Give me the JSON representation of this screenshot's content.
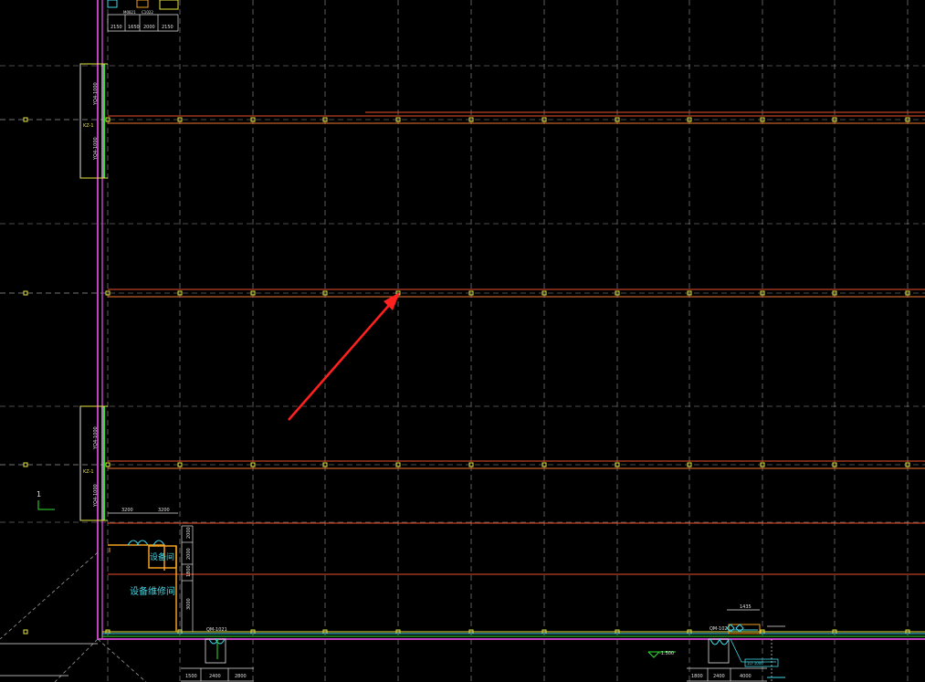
{
  "canvas": {
    "background": "#000000"
  },
  "colors": {
    "grid_dashed": "#9a9a9a",
    "beam_red": "#e8502a",
    "beam_orange": "#f07a30",
    "wall_magenta": "#c040c0",
    "wall_green": "#30e030",
    "column_yellow": "#e8e840",
    "label_cyan": "#40d8e8",
    "dim_white": "#e0e0e0",
    "arrow_red": "#ff2020",
    "room_orange": "#f0a020"
  },
  "rooms": {
    "equipment_repair_label": "设备维修间",
    "small_room_label": "设备间"
  },
  "tags": {
    "wall_tag_upper": "YQ4-1000",
    "wall_tag_lower": "YQ4-1000",
    "column_tag_upper": "KZ-1",
    "column_tag_lower": "KZ-1",
    "axis_number": "1",
    "door_tag_bottom": "QM-1021",
    "door_tag_right": "QM-1021",
    "stair_tag": "1LT-1000",
    "top_door_tag": "M0821",
    "top_window_tag": "C1022"
  },
  "dimensions": {
    "top_row": [
      "2150",
      "1650",
      "2000",
      "2150"
    ],
    "left_bottom_row": [
      "3200",
      "3200"
    ],
    "left_side_col": [
      "2000",
      "2000",
      "1800",
      "3000"
    ],
    "bottom_left_row": [
      "1500",
      "2400",
      "2800"
    ],
    "bottom_right_row": [
      "1800",
      "2400",
      "4000"
    ],
    "level_mark": "-1.500",
    "right_top": "1435"
  },
  "icons": {
    "pointer": "red-arrow-icon",
    "axis_marker": "axis-l-icon"
  }
}
